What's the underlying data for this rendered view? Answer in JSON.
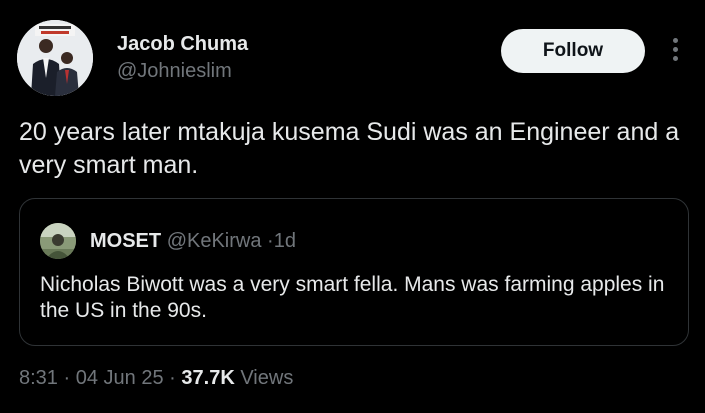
{
  "author": {
    "name": "Jacob Chuma",
    "handle": "@Johnieslim",
    "avatar": {
      "icon": "profile-photo-two-men-in-suits"
    }
  },
  "actions": {
    "follow_label": "Follow",
    "more_icon": "more-vertical-icon"
  },
  "tweet": {
    "text": "20 years later mtakuja kusema Sudi was an Engineer and a very smart man."
  },
  "quote": {
    "name": "MOSET",
    "handle": "@KeKirwa",
    "separator": "·",
    "age": "1d",
    "text": "Nicholas Biwott was a very smart fella. Mans was farming apples in the US in the 90s.",
    "avatar": {
      "icon": "profile-photo-outdoor"
    }
  },
  "meta": {
    "time": "8:31",
    "sep1": "·",
    "date": "04 Jun 25",
    "sep2": "·",
    "views_count": "37.7K",
    "views_label": "Views"
  },
  "colors": {
    "background": "#000000",
    "text_primary": "#e7e9ea",
    "text_secondary": "#71767b",
    "border": "#2f3336",
    "follow_button_bg": "#eff3f4"
  }
}
